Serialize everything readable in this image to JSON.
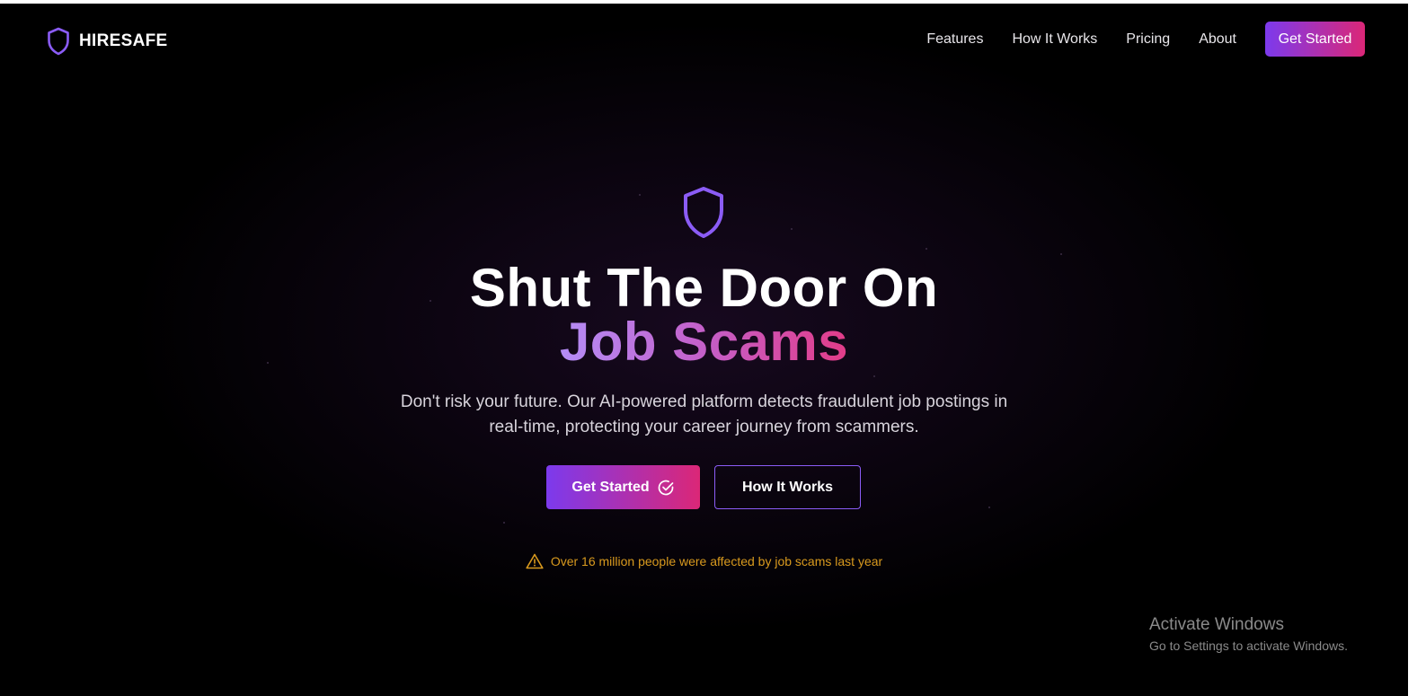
{
  "brand": {
    "name": "HIRESAFE",
    "icon": "shield-icon",
    "accent_color": "#8b5cf6"
  },
  "nav": {
    "links": [
      "Features",
      "How It Works",
      "Pricing",
      "About"
    ],
    "cta_label": "Get Started"
  },
  "hero": {
    "icon": "shield-icon",
    "title_line1": "Shut The Door On",
    "title_line2": "Job Scams",
    "description": "Don't risk your future. Our AI-powered platform detects fraudulent job postings in real-time, protecting your career journey from scammers.",
    "primary_button": "Get Started",
    "primary_button_icon": "check-circle-icon",
    "secondary_button": "How It Works",
    "warning_icon": "warning-triangle-icon",
    "warning_text": "Over 16 million people were affected by job scams last year"
  },
  "colors": {
    "gradient_start": "#7c3aed",
    "gradient_end": "#db2777",
    "warning": "#d99a1e",
    "background": "#000000"
  },
  "watermark": {
    "title": "Activate Windows",
    "subtitle": "Go to Settings to activate Windows."
  }
}
